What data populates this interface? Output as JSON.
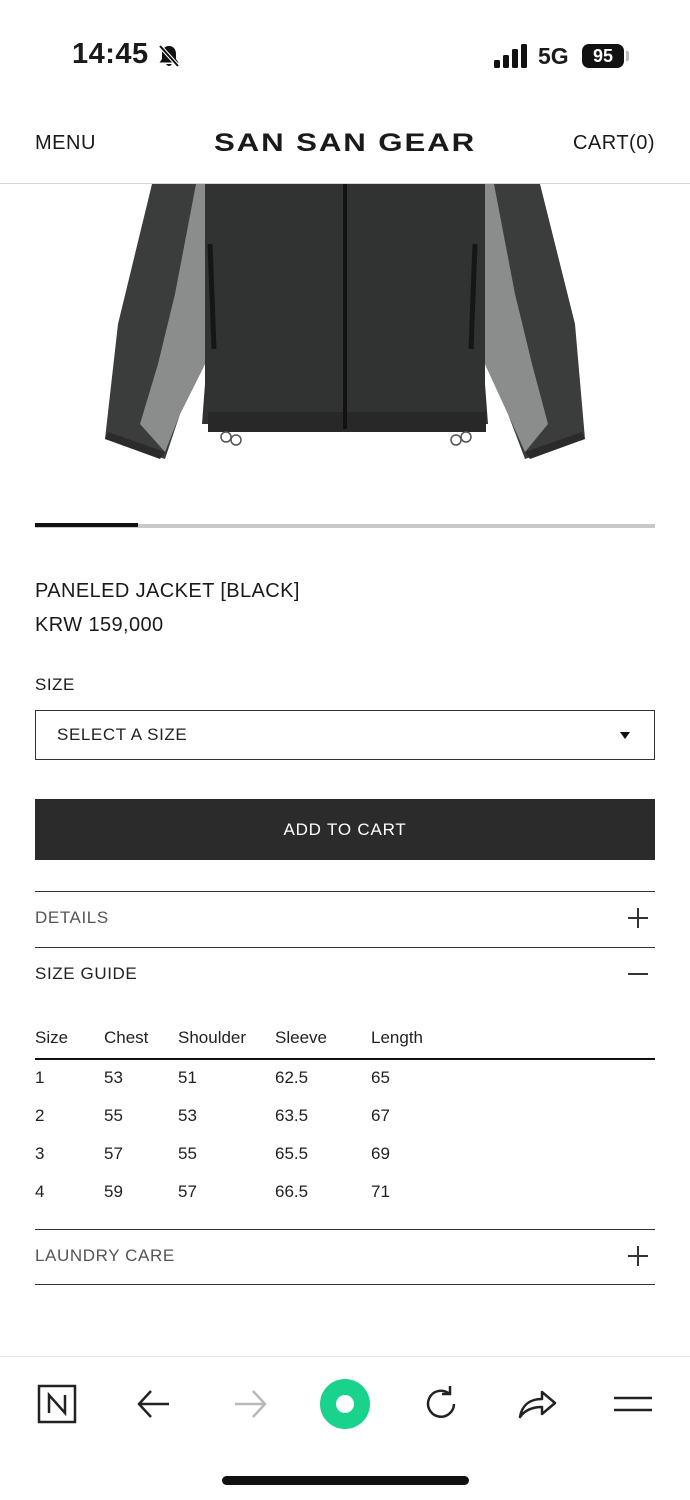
{
  "status": {
    "time": "14:45",
    "network": "5G",
    "battery": "95"
  },
  "header": {
    "menu_label": "MENU",
    "brand": "SAN SAN GEAR",
    "cart_label": "CART(0)"
  },
  "carousel": {
    "current": 1,
    "total": 6
  },
  "product": {
    "title": "PANELED JACKET [BLACK]",
    "price": "KRW 159,000"
  },
  "size_selector": {
    "label": "SIZE",
    "value": "SELECT A SIZE"
  },
  "add_to_cart_label": "ADD TO CART",
  "accordions": {
    "details": "DETAILS",
    "size_guide": "SIZE GUIDE",
    "laundry_care": "LAUNDRY CARE"
  },
  "size_guide": {
    "headers": [
      "Size",
      "Chest",
      "Shoulder",
      "Sleeve",
      "Length"
    ],
    "rows": [
      [
        "1",
        "53",
        "51",
        "62.5",
        "65"
      ],
      [
        "2",
        "55",
        "53",
        "63.5",
        "67"
      ],
      [
        "3",
        "57",
        "55",
        "65.5",
        "69"
      ],
      [
        "4",
        "59",
        "57",
        "66.5",
        "71"
      ]
    ]
  },
  "browser_bar": {
    "icons": [
      "naver-icon",
      "back-arrow-icon",
      "forward-arrow-icon",
      "green-dot-icon",
      "reload-icon",
      "share-icon",
      "menu-lines-icon"
    ],
    "accent": "#19d28b"
  }
}
